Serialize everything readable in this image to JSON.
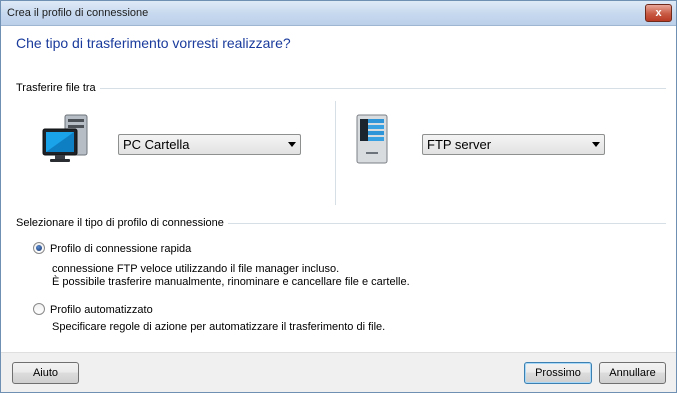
{
  "window": {
    "title": "Crea il profilo di connessione",
    "close_label": "x"
  },
  "heading": "Che tipo di trasferimento vorresti realizzare?",
  "transfer": {
    "group_label": "Trasferire file tra",
    "left_select": "PC Cartella",
    "right_select": "FTP server"
  },
  "profile": {
    "group_label": "Selezionare il tipo di profilo di connessione",
    "options": [
      {
        "label": "Profilo di connessione rapida",
        "checked": true,
        "desc1": "connessione FTP veloce utilizzando il file manager incluso.",
        "desc2": "È possibile trasferire manualmente, rinominare e cancellare file e cartelle."
      },
      {
        "label": "Profilo automatizzato",
        "checked": false,
        "desc1": "Specificare regole di azione per automatizzare il trasferimento di file."
      }
    ]
  },
  "footer": {
    "help": "Aiuto",
    "next": "Prossimo",
    "cancel": "Annullare"
  },
  "icons": {
    "left": "computer-icon",
    "right": "server-icon"
  }
}
